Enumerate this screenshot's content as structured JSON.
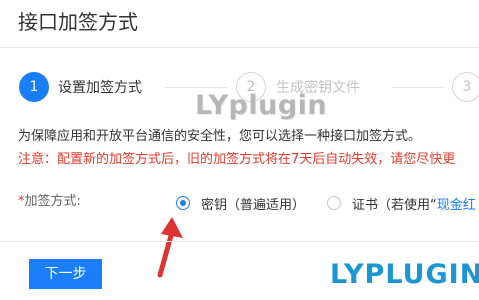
{
  "dialog": {
    "title": "接口加签方式"
  },
  "steps": [
    {
      "number": "1",
      "label": "设置加签方式"
    },
    {
      "number": "2",
      "label": "生成密钥文件"
    },
    {
      "number": "3",
      "label": ""
    }
  ],
  "watermarks": {
    "top": "LYplugin",
    "bottom": "LYPLUGIN"
  },
  "content": {
    "description": "为保障应用和开放平台通信的安全性，您可以选择一种接口加签方式。",
    "notice": "注意：配置新的加签方式后，旧的加签方式将在7天后自动失效，请您尽快更"
  },
  "form": {
    "required_mark": "*",
    "label": "加签方式:",
    "options": [
      {
        "label": "密钥（普遍适用）"
      },
      {
        "label_prefix": "证书（若使用“",
        "link": "现金红"
      }
    ]
  },
  "footer": {
    "next_button": "下一步"
  },
  "colors": {
    "primary": "#1a7ef8",
    "warning": "#e23b2c",
    "watermark_top": "#b7b7b7",
    "watermark_bottom": "#1a96d5",
    "arrow": "#dd3333"
  },
  "icons": {
    "selected_radio": "radio-selected-icon",
    "unselected_radio": "radio-unselected-icon",
    "pointer": "red-arrow-icon"
  }
}
